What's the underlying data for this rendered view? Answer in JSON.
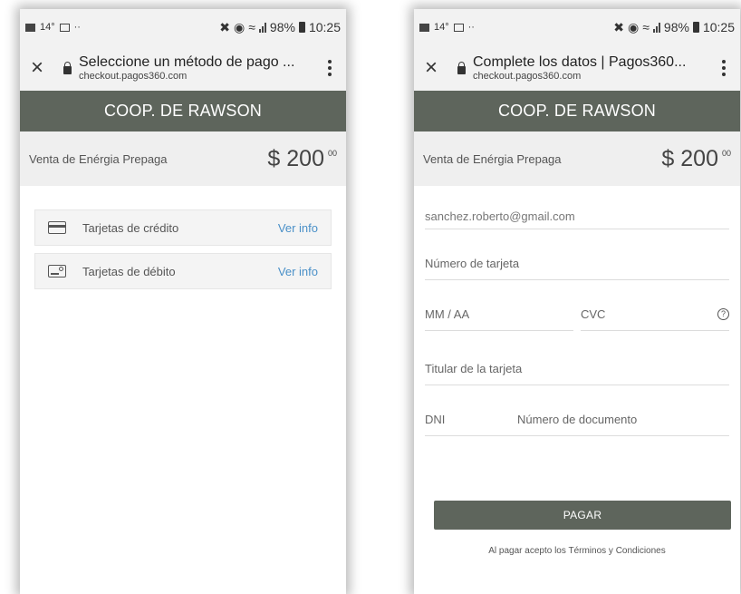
{
  "status_bar": {
    "temp": "14°",
    "dots": "··",
    "battery": "98%",
    "time": "10:25"
  },
  "screens": [
    {
      "url_title": "Seleccione un método de pago ...",
      "url_host": "checkout.pagos360.com",
      "merchant": "COOP. DE RAWSON",
      "description": "Venta de Enérgia Prepaga",
      "amount": "$ 200",
      "cents": "00",
      "methods": [
        {
          "label": "Tarjetas de crédito",
          "action": "Ver info",
          "icon": "credit-card-icon"
        },
        {
          "label": "Tarjetas de débito",
          "action": "Ver info",
          "icon": "debit-card-icon"
        }
      ]
    },
    {
      "url_title": "Complete los datos | Pagos360...",
      "url_host": "checkout.pagos360.com",
      "merchant": "COOP. DE RAWSON",
      "description": "Venta de Enérgia Prepaga",
      "amount": "$ 200",
      "cents": "00",
      "form": {
        "email_value": "sanchez.roberto@gmail.com",
        "card_number_placeholder": "Número de tarjeta",
        "expiry_placeholder": "MM / AA",
        "cvc_placeholder": "CVC",
        "holder_placeholder": "Titular de la tarjeta",
        "dni_label": "DNI",
        "document_placeholder": "Número de documento",
        "pay_label": "PAGAR",
        "terms_text": "Al pagar acepto los Términos y Condiciones"
      }
    }
  ],
  "colors": {
    "header_bg": "#5e655c",
    "link": "#4a90c8",
    "chrome_bg": "#f2f2f2"
  }
}
